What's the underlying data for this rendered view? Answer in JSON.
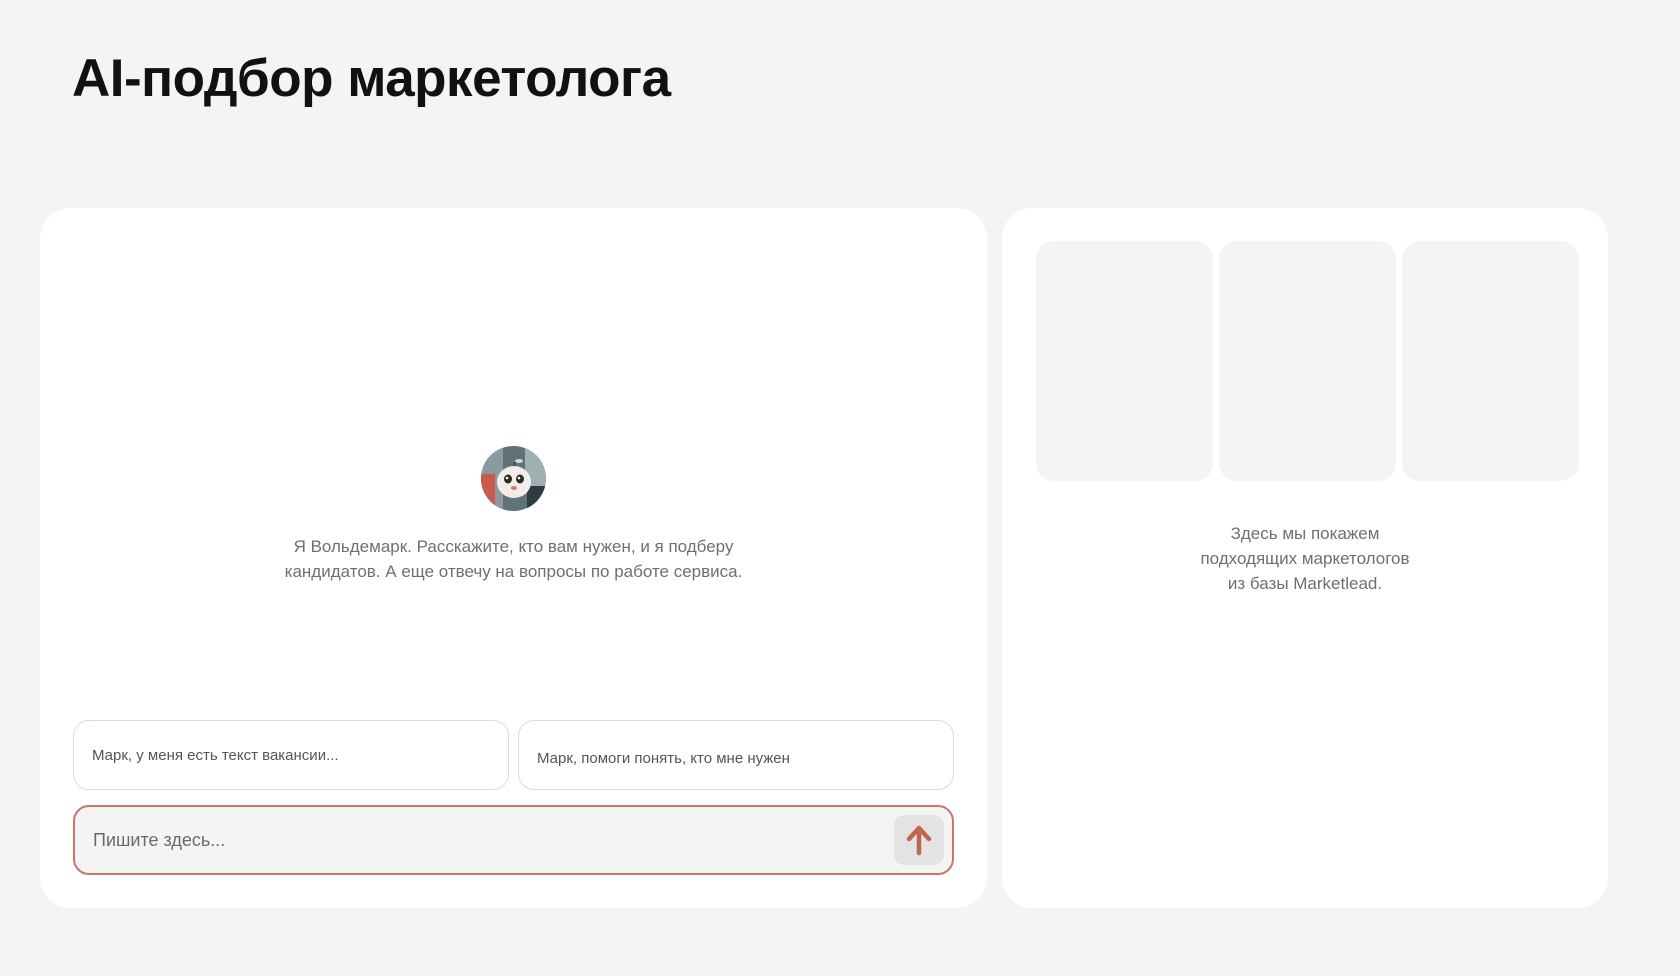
{
  "page": {
    "title": "AI-подбор маркетолога"
  },
  "chat": {
    "avatar_icon": "assistant-avatar-icon",
    "welcome_text": "Я Вольдемарк. Расскажите, кто вам нужен, и я подберу\nкандидатов. А еще отвечу на вопросы по работе сервиса.",
    "suggestions": [
      {
        "label": "Марк, у меня есть текст вакансии..."
      },
      {
        "label": "Марк, помоги понять, кто мне нужен"
      }
    ],
    "composer": {
      "placeholder": "Пишите здесь...",
      "value": "",
      "send_icon": "arrow-up-icon"
    }
  },
  "results": {
    "placeholder_text": "Здесь мы покажем\nподходящих маркетологов\nиз базы Marketlead."
  },
  "colors": {
    "background": "#f4f4f4",
    "panel": "#ffffff",
    "accent": "#c9766a",
    "send_arrow": "#c0654f",
    "skeleton": "#f4f4f4"
  }
}
